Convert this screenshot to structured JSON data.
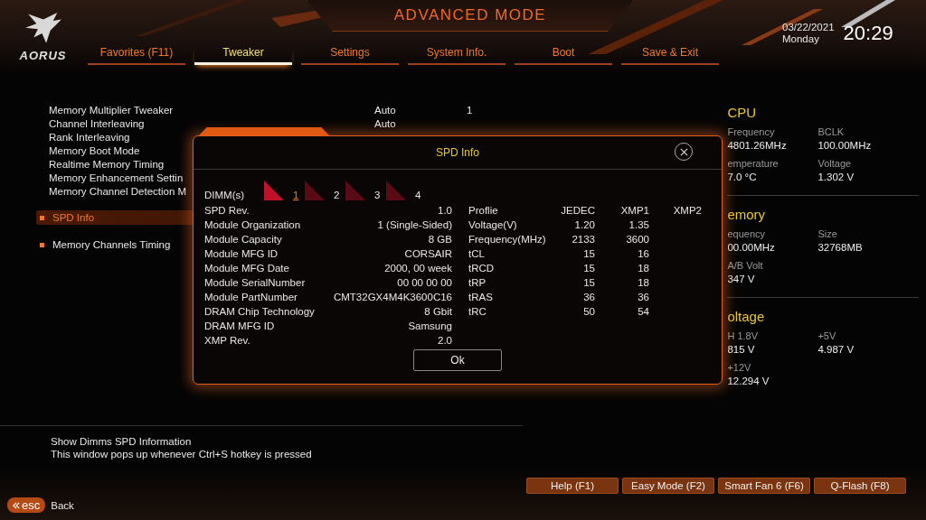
{
  "header": {
    "logo_text": "AORUS",
    "title": "ADVANCED MODE",
    "date": "03/22/2021",
    "weekday": "Monday",
    "time": "20:29"
  },
  "tabs": [
    {
      "label": "Favorites (F11)",
      "selected": false
    },
    {
      "label": "Tweaker",
      "selected": true
    },
    {
      "label": "Settings",
      "selected": false
    },
    {
      "label": "System Info.",
      "selected": false
    },
    {
      "label": "Boot",
      "selected": false
    },
    {
      "label": "Save & Exit",
      "selected": false
    }
  ],
  "settings": [
    {
      "kind": "option",
      "label": "Memory Multiplier Tweaker",
      "value": "Auto",
      "value_2": "1"
    },
    {
      "kind": "option",
      "label": "Channel Interleaving",
      "value": "Auto"
    },
    {
      "kind": "option",
      "label": "Rank Interleaving"
    },
    {
      "kind": "option",
      "label": "Memory Boot Mode"
    },
    {
      "kind": "option",
      "label": "Realtime Memory Timing"
    },
    {
      "kind": "option",
      "label": "Memory Enhancement Settin"
    },
    {
      "kind": "option",
      "label": "Memory Channel Detection M"
    },
    {
      "kind": "submenu",
      "label": "SPD Info",
      "selected": true
    },
    {
      "kind": "submenu",
      "label": "Memory Channels Timing",
      "selected": false
    }
  ],
  "help_text": [
    "Show Dimms SPD Information",
    "This window pops up whenever Ctrl+S hotkey is pressed"
  ],
  "info_panel": [
    {
      "title": "CPU",
      "items": [
        {
          "label": "Frequency",
          "value": "4801.26MHz"
        },
        {
          "label": "BCLK",
          "value": "100.00MHz"
        },
        {
          "label": "emperature",
          "value": "7.0 °C"
        },
        {
          "label": "Voltage",
          "value": "1.302 V"
        }
      ]
    },
    {
      "title": "emory",
      "items": [
        {
          "label": "equency",
          "value": "00.00MHz"
        },
        {
          "label": "Size",
          "value": "32768MB"
        },
        {
          "label": "A/B Volt",
          "value": "347 V"
        }
      ]
    },
    {
      "title": "oltage",
      "items": [
        {
          "label": "H 1.8V",
          "value": "815 V"
        },
        {
          "label": "+5V",
          "value": "4.987 V"
        },
        {
          "label": "+12V",
          "value": "12.294 V"
        }
      ]
    }
  ],
  "dialog": {
    "title": "SPD Info",
    "dimm_label": "DIMM(s)",
    "dimms": [
      {
        "label": "1",
        "selected": true
      },
      {
        "label": "2",
        "selected": false
      },
      {
        "label": "3",
        "selected": false
      },
      {
        "label": "4",
        "selected": false
      }
    ],
    "module_info": [
      {
        "label": "SPD Rev.",
        "value": "1.0"
      },
      {
        "label": "Module Organization",
        "value": "1 (Single-Sided)"
      },
      {
        "label": "Module Capacity",
        "value": "8 GB"
      },
      {
        "label": "Module MFG ID",
        "value": "CORSAIR"
      },
      {
        "label": "Module MFG Date",
        "value": "2000, 00 week"
      },
      {
        "label": "Module SerialNumber",
        "value": "00 00 00 00"
      },
      {
        "label": "Module PartNumber",
        "value": "CMT32GX4M4K3600C16"
      },
      {
        "label": "DRAM Chip Technology",
        "value": "8 Gbit"
      },
      {
        "label": "DRAM MFG ID",
        "value": "Samsung"
      },
      {
        "label": "XMP Rev.",
        "value": "2.0"
      }
    ],
    "profile_columns": [
      "Proflie",
      "JEDEC",
      "XMP1",
      "XMP2"
    ],
    "profile_rows": [
      {
        "name": "Voltage(V)",
        "values": [
          "1.20",
          "1.35"
        ]
      },
      {
        "name": "Frequency(MHz)",
        "values": [
          "2133",
          "3600"
        ]
      },
      {
        "name": "tCL",
        "values": [
          "15",
          "16"
        ]
      },
      {
        "name": "tRCD",
        "values": [
          "15",
          "18"
        ]
      },
      {
        "name": "tRP",
        "values": [
          "15",
          "18"
        ]
      },
      {
        "name": "tRAS",
        "values": [
          "36",
          "36"
        ]
      },
      {
        "name": "tRC",
        "values": [
          "50",
          "54"
        ]
      }
    ],
    "ok_button": "Ok"
  },
  "footer_buttons": [
    "Help (F1)",
    "Easy Mode (F2)",
    "Smart Fan 6 (F6)",
    "Q-Flash (F8)"
  ],
  "back": {
    "key": "esc",
    "label": "Back"
  }
}
